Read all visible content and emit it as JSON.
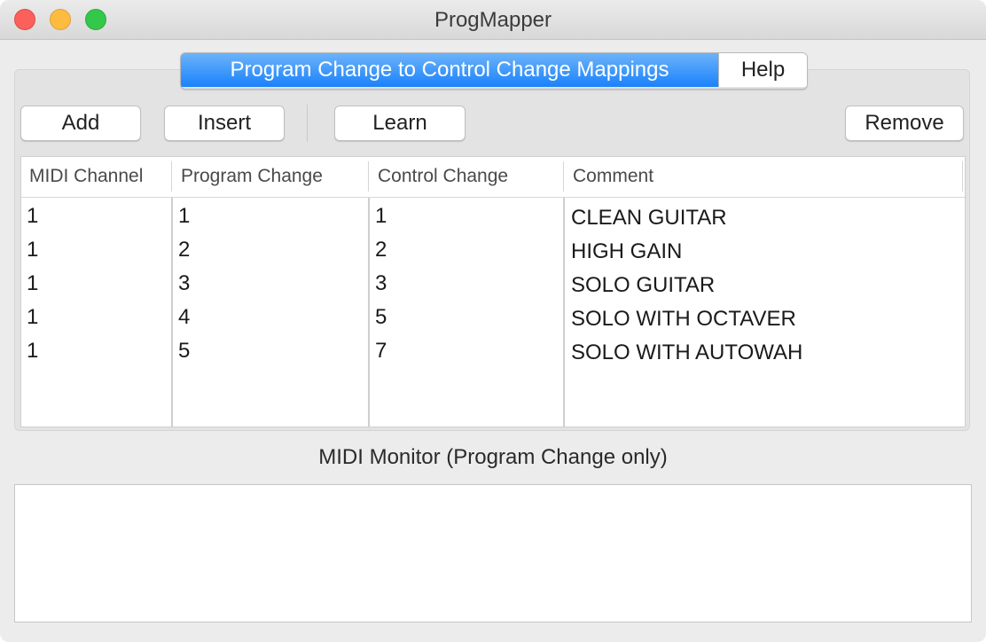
{
  "window": {
    "title": "ProgMapper"
  },
  "tabs": {
    "active_label": "Program Change to Control Change Mappings",
    "help_label": "Help"
  },
  "toolbar": {
    "add_label": "Add",
    "insert_label": "Insert",
    "learn_label": "Learn",
    "remove_label": "Remove"
  },
  "table": {
    "headers": [
      "MIDI Channel",
      "Program Change",
      "Control Change",
      "Comment"
    ],
    "rows": [
      [
        "1",
        "1",
        "1",
        "CLEAN GUITAR"
      ],
      [
        "1",
        "2",
        "2",
        "HIGH GAIN"
      ],
      [
        "1",
        "3",
        "3",
        "SOLO GUITAR"
      ],
      [
        "1",
        "4",
        "5",
        "SOLO WITH OCTAVER"
      ],
      [
        "1",
        "5",
        "7",
        "SOLO WITH AUTOWAH"
      ]
    ]
  },
  "monitor": {
    "label": "MIDI Monitor (Program Change only)",
    "content": ""
  },
  "colors": {
    "accent": "#1a82fb",
    "close": "#fc605b",
    "minimize": "#fdbc40",
    "maximize": "#34c84a"
  }
}
